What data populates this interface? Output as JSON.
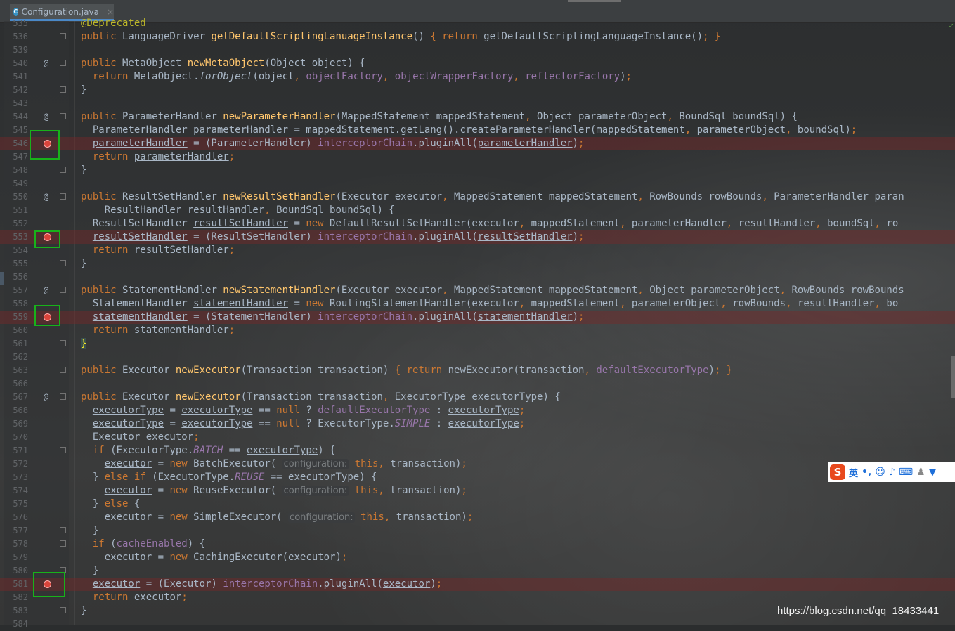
{
  "tab": {
    "filename": "Configuration.java",
    "icon": "java-class-icon",
    "close": "×"
  },
  "watermark": "https://blog.csdn.net/qq_18433441",
  "ime": {
    "lang": "英",
    "punct": "•,"
  },
  "colors": {
    "keyword": "#cc7832",
    "method": "#ffc66d",
    "field": "#9876aa",
    "annotation": "#bbb529",
    "breakpoint": "#d9443b",
    "highlight_box": "#18b21a"
  },
  "lines": [
    {
      "n": "535",
      "html": "<span class=\"ann\">@Deprecated</span>"
    },
    {
      "n": "536",
      "fold": true,
      "html": "<span class=\"kw\">public</span> LanguageDriver <span class=\"fn\">getDefaultScriptingLanuageInstance</span>() <span class=\"kw\">{ return</span> getDefaultScriptingLanguageInstance()<span class=\"kw\">; }</span>"
    },
    {
      "n": "539",
      "html": ""
    },
    {
      "n": "540",
      "at": true,
      "fold": true,
      "html": "<span class=\"kw\">public</span> MetaObject <span class=\"fn\">newMetaObject</span>(Object object) {"
    },
    {
      "n": "541",
      "html": "  <span class=\"kw\">return</span> MetaObject.<span class=\"ital\">forObject</span>(object<span class=\"kw\">,</span> <span class=\"fld\">objectFactory</span><span class=\"kw\">,</span> <span class=\"fld\">objectWrapperFactory</span><span class=\"kw\">,</span> <span class=\"fld\">reflectorFactory</span>)<span class=\"kw\">;</span>"
    },
    {
      "n": "542",
      "fold": true,
      "html": "}"
    },
    {
      "n": "543",
      "html": ""
    },
    {
      "n": "544",
      "at": true,
      "fold": true,
      "html": "<span class=\"kw\">public</span> ParameterHandler <span class=\"fn\">newParameterHandler</span>(MappedStatement mappedStatement<span class=\"kw\">,</span> Object parameterObject<span class=\"kw\">,</span> BoundSql boundSql) {"
    },
    {
      "n": "545",
      "html": "  ParameterHandler <span class=\"u\">parameterHandler</span> = mappedStatement.getLang().createParameterHandler(mappedStatement<span class=\"kw\">,</span> parameterObject<span class=\"kw\">,</span> boundSql)<span class=\"kw\">;</span>"
    },
    {
      "n": "546",
      "bp": true,
      "html": "  <span class=\"u\">parameterHandler</span> = (ParameterHandler) <span class=\"fld\">interceptorChain</span>.pluginAll(<span class=\"u\">parameterHandler</span>)<span class=\"kw\">;</span>"
    },
    {
      "n": "547",
      "html": "  <span class=\"kw\">return</span> <span class=\"u\">parameterHandler</span><span class=\"kw\">;</span>"
    },
    {
      "n": "548",
      "fold": true,
      "html": "}"
    },
    {
      "n": "549",
      "html": ""
    },
    {
      "n": "550",
      "at": true,
      "fold": true,
      "html": "<span class=\"kw\">public</span> ResultSetHandler <span class=\"fn\">newResultSetHandler</span>(Executor executor<span class=\"kw\">,</span> MappedStatement mappedStatement<span class=\"kw\">,</span> RowBounds rowBounds<span class=\"kw\">,</span> ParameterHandler paran"
    },
    {
      "n": "551",
      "html": "    ResultHandler resultHandler<span class=\"kw\">,</span> BoundSql boundSql) {"
    },
    {
      "n": "552",
      "html": "  ResultSetHandler <span class=\"u\">resultSetHandler</span> = <span class=\"kw\">new</span> DefaultResultSetHandler(executor<span class=\"kw\">,</span> mappedStatement<span class=\"kw\">,</span> parameterHandler<span class=\"kw\">,</span> resultHandler<span class=\"kw\">,</span> boundSql<span class=\"kw\">,</span> ro"
    },
    {
      "n": "553",
      "bp": true,
      "html": "  <span class=\"u\">resultSetHandler</span> = (ResultSetHandler) <span class=\"fld\">interceptorChain</span>.pluginAll(<span class=\"u\">resultSetHandler</span>)<span class=\"kw\">;</span>"
    },
    {
      "n": "554",
      "html": "  <span class=\"kw\">return</span> <span class=\"u\">resultSetHandler</span><span class=\"kw\">;</span>"
    },
    {
      "n": "555",
      "fold": true,
      "html": "}"
    },
    {
      "n": "556",
      "html": ""
    },
    {
      "n": "557",
      "at": true,
      "fold": true,
      "html": "<span class=\"kw\">public</span> StatementHandler <span class=\"fn\">newStatementHandler</span>(Executor executor<span class=\"kw\">,</span> MappedStatement mappedStatement<span class=\"kw\">,</span> Object parameterObject<span class=\"kw\">,</span> RowBounds rowBounds"
    },
    {
      "n": "558",
      "html": "  StatementHandler <span class=\"u\">statementHandler</span> = <span class=\"kw\">new</span> RoutingStatementHandler(executor<span class=\"kw\">,</span> mappedStatement<span class=\"kw\">,</span> parameterObject<span class=\"kw\">,</span> rowBounds<span class=\"kw\">,</span> resultHandler<span class=\"kw\">,</span> bo"
    },
    {
      "n": "559",
      "bp": true,
      "html": "  <span class=\"u\">statementHandler</span> = (StatementHandler) <span class=\"fld\">interceptorChain</span>.pluginAll(<span class=\"u\">statementHandler</span>)<span class=\"kw\">;</span>"
    },
    {
      "n": "560",
      "html": "  <span class=\"kw\">return</span> <span class=\"u\">statementHandler</span><span class=\"kw\">;</span>"
    },
    {
      "n": "561",
      "fold": true,
      "html": "<span class=\"hlbrace\">}</span>"
    },
    {
      "n": "562",
      "html": ""
    },
    {
      "n": "563",
      "fold": true,
      "html": "<span class=\"kw\">public</span> Executor <span class=\"fn\">newExecutor</span>(Transaction transaction) <span class=\"kw\">{ return</span> newExecutor(transaction<span class=\"kw\">,</span> <span class=\"fld\">defaultExecutorType</span>)<span class=\"kw\">; }</span>"
    },
    {
      "n": "566",
      "html": ""
    },
    {
      "n": "567",
      "at": true,
      "fold": true,
      "html": "<span class=\"kw\">public</span> Executor <span class=\"fn\">newExecutor</span>(Transaction transaction<span class=\"kw\">,</span> ExecutorType <span class=\"u\">executorType</span>) {"
    },
    {
      "n": "568",
      "html": "  <span class=\"u\">executorType</span> = <span class=\"u\">executorType</span> == <span class=\"kw\">null</span> ? <span class=\"fld\">defaultExecutorType</span> : <span class=\"u\">executorType</span><span class=\"kw\">;</span>"
    },
    {
      "n": "569",
      "html": "  <span class=\"u\">executorType</span> = <span class=\"u\">executorType</span> == <span class=\"kw\">null</span> ? ExecutorType.<span class=\"fld ital\">SIMPLE</span> : <span class=\"u\">executorType</span><span class=\"kw\">;</span>"
    },
    {
      "n": "570",
      "html": "  Executor <span class=\"u\">executor</span><span class=\"kw\">;</span>"
    },
    {
      "n": "571",
      "fold": true,
      "html": "  <span class=\"kw\">if</span> (ExecutorType.<span class=\"fld ital\">BATCH</span> == <span class=\"u\">executorType</span>) {"
    },
    {
      "n": "572",
      "html": "    <span class=\"u\">executor</span> = <span class=\"kw\">new</span> BatchExecutor( <span class=\"hint\">configuration:</span> <span class=\"kw\">this,</span> transaction)<span class=\"kw\">;</span>"
    },
    {
      "n": "573",
      "html": "  } <span class=\"kw\">else if</span> (ExecutorType.<span class=\"fld ital\">REUSE</span> == <span class=\"u\">executorType</span>) {"
    },
    {
      "n": "574",
      "html": "    <span class=\"u\">executor</span> = <span class=\"kw\">new</span> ReuseExecutor( <span class=\"hint\">configuration:</span> <span class=\"kw\">this,</span> transaction)<span class=\"kw\">;</span>"
    },
    {
      "n": "575",
      "html": "  } <span class=\"kw\">else</span> {"
    },
    {
      "n": "576",
      "html": "    <span class=\"u\">executor</span> = <span class=\"kw\">new</span> SimpleExecutor( <span class=\"hint\">configuration:</span> <span class=\"kw\">this,</span> transaction)<span class=\"kw\">;</span>"
    },
    {
      "n": "577",
      "fold": true,
      "html": "  }"
    },
    {
      "n": "578",
      "fold": true,
      "html": "  <span class=\"kw\">if</span> (<span class=\"fld\">cacheEnabled</span>) {"
    },
    {
      "n": "579",
      "html": "    <span class=\"u\">executor</span> = <span class=\"kw\">new</span> CachingExecutor(<span class=\"u\">executor</span>)<span class=\"kw\">;</span>"
    },
    {
      "n": "580",
      "fold": true,
      "html": "  }"
    },
    {
      "n": "581",
      "bp": true,
      "html": "  <span class=\"u\">executor</span> = (Executor) <span class=\"fld\">interceptorChain</span>.pluginAll(<span class=\"u\">executor</span>)<span class=\"kw\">;</span>"
    },
    {
      "n": "582",
      "html": "  <span class=\"kw\">return</span> <span class=\"u\">executor</span><span class=\"kw\">;</span>"
    },
    {
      "n": "583",
      "fold": true,
      "html": "}"
    },
    {
      "n": "584",
      "html": ""
    }
  ]
}
